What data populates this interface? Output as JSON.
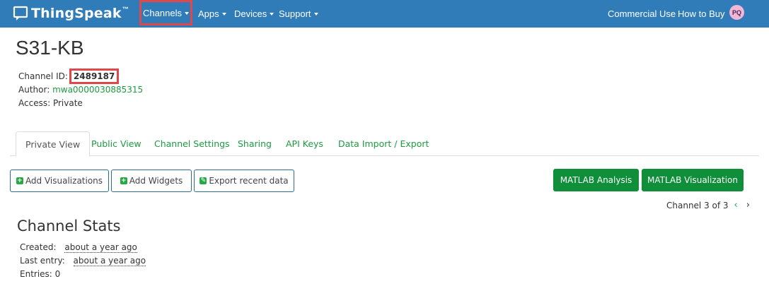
{
  "navbar": {
    "brand": "ThingSpeak",
    "brand_tm": "™",
    "items": [
      "Channels",
      "Apps",
      "Devices",
      "Support"
    ],
    "commercial_use": "Commercial Use",
    "how_to_buy": "How to Buy",
    "avatar_initials": "PQ",
    "bg_color": "#2f7cb8",
    "highlight_color": "#e0474c"
  },
  "channel": {
    "title": "S31-KB",
    "id_label": "Channel ID:",
    "id": "2489187",
    "author_label": "Author:",
    "author": "mwa0000030885315",
    "access_label": "Access:",
    "access": "Private"
  },
  "tabs": [
    "Private View",
    "Public View",
    "Channel Settings",
    "Sharing",
    "API Keys",
    "Data Import / Export"
  ],
  "buttons": {
    "add_visualizations": "Add Visualizations",
    "add_widgets": "Add Widgets",
    "export_recent": "Export recent data",
    "matlab_analysis": "MATLAB Analysis",
    "matlab_visualization": "MATLAB Visualization"
  },
  "pager": {
    "text": "Channel 3 of 3",
    "prev": "‹",
    "next": "›"
  },
  "stats": {
    "title": "Channel Stats",
    "created_label": "Created:",
    "created": "about a year ago",
    "last_entry_label": "Last entry:",
    "last_entry": "about a year ago",
    "entries_label": "Entries:",
    "entries": "0"
  },
  "colors": {
    "accent_green": "#1e9b40",
    "button_green": "#0f8f3a"
  }
}
